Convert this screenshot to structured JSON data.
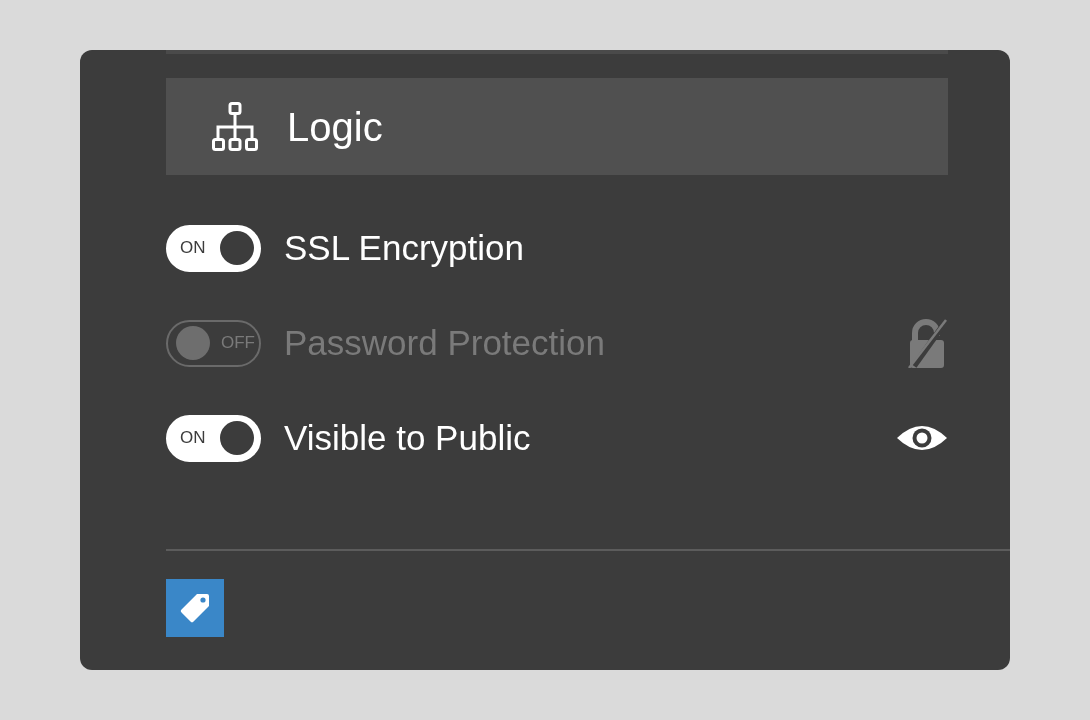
{
  "header": {
    "title": "Logic"
  },
  "settings": [
    {
      "kind": "plain",
      "label": "SSL Encryption",
      "switch_text": "ON",
      "on": true,
      "disabled": false
    },
    {
      "kind": "password",
      "label": "Password Protection",
      "switch_text": "OFF",
      "on": false,
      "disabled": true
    },
    {
      "kind": "visibility",
      "label": "Visible to Public",
      "switch_text": "ON",
      "on": true,
      "disabled": false
    }
  ]
}
